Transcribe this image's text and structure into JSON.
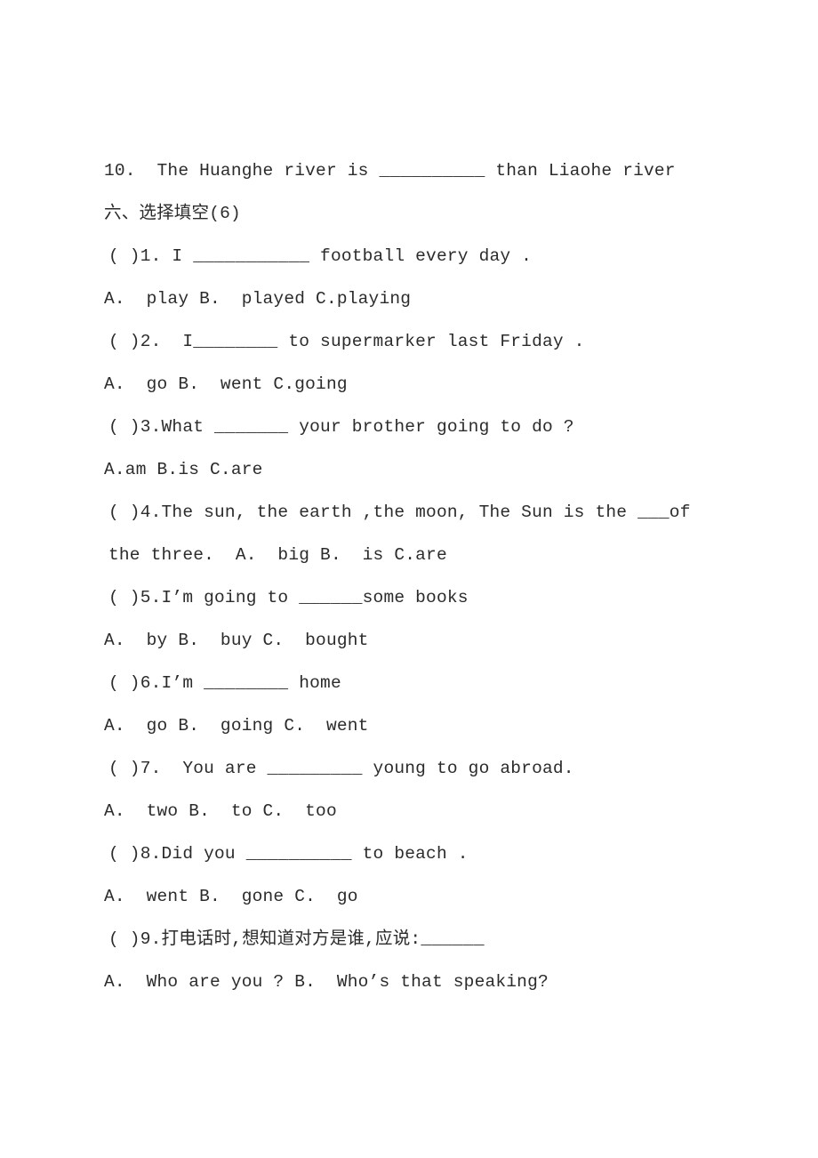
{
  "document": {
    "type": "worksheet-page",
    "background_color": "#ffffff",
    "text_color": "#2b2b2b",
    "carryover_item": "10.  The Huanghe river is __________ than Liaohe river",
    "section_heading": "六、选择填空(6)",
    "questions": [
      {
        "stem": "( )1. I ___________ football every day .",
        "options": "A.  play B.  played C.playing"
      },
      {
        "stem": "( )2.  I________ to supermarker last Friday .",
        "options": "A.  go B.  went C.going"
      },
      {
        "stem": "( )3.What _______ your brother going to do ?",
        "options": "A.am B.is C.are"
      },
      {
        "stem": "( )4.The sun, the earth ,the moon, The Sun is the ___of the three.  A.  big B.  is C.are",
        "options": ""
      },
      {
        "stem": "( )5.I’m going to ______some books",
        "options": "A.  by B.  buy C.  bought"
      },
      {
        "stem": "( )6.I’m ________ home",
        "options": "A.  go B.  going C.  went"
      },
      {
        "stem": "( )7.  You are _________ young to go abroad.",
        "options": "A.  two B.  to C.  too"
      },
      {
        "stem": "( )8.Did you __________ to beach .",
        "options": "A.  went B.  gone C.  go"
      },
      {
        "stem": "( )9.打电话时,想知道对方是谁,应说:______",
        "options": "A.  Who are you ? B.  Who’s that speaking?"
      }
    ]
  }
}
